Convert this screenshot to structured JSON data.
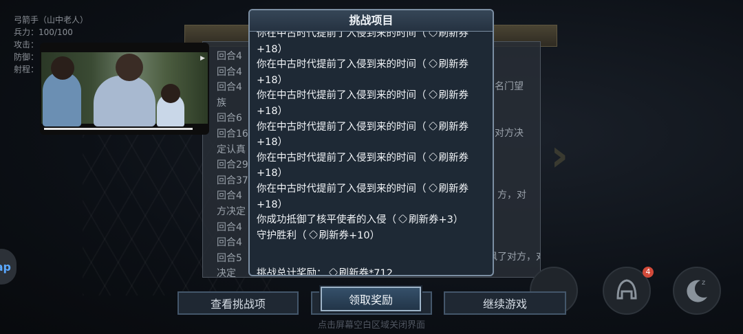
{
  "background": {
    "stats": [
      "弓箭手（山中老人）",
      "兵力：100/100",
      "攻击：",
      "防御：",
      "射程："
    ],
    "log_lines": [
      {
        "text": "回合4"
      },
      {
        "text": "回合4"
      },
      {
        "text": "回合4"
      },
      {
        "text": "族"
      },
      {
        "text": "回合6"
      },
      {
        "text": "回合16"
      },
      {
        "text": "定认真"
      },
      {
        "text": "回合29"
      },
      {
        "text": "回合37"
      },
      {
        "text": "回合4"
      },
      {
        "text": "方决定"
      },
      {
        "text": "回合4"
      },
      {
        "text": "回合4"
      },
      {
        "text": "回合5"
      },
      {
        "text": "决定"
      }
    ],
    "log_right": [
      {
        "text": "名门望"
      },
      {
        "text": "对方决"
      },
      {
        "text": "方，对"
      },
      {
        "text": "的骑士，你嘲讽了对方，对方"
      }
    ],
    "tap_label": "ap",
    "notification_count": "4"
  },
  "modal": {
    "title": "挑战项目",
    "entries": [
      "你在中古时代提前了入侵到来的时间（[t]刷新券+18）",
      "你在中古时代提前了入侵到来的时间（[t]刷新券+18）",
      "你在中古时代提前了入侵到来的时间（[t]刷新券+18）",
      "你在中古时代提前了入侵到来的时间（[t]刷新券+18）",
      "你在中古时代提前了入侵到来的时间（[t]刷新券+18）",
      "你在中古时代提前了入侵到来的时间（[t]刷新券+18）",
      "你成功抵御了核平使者的入侵（[t]刷新券+3）",
      "守护胜利（[t]刷新券+10）"
    ],
    "total_label": "挑战总计奖励：",
    "total_value": "刷新券*712",
    "ticket_icon": "ticket-icon"
  },
  "buttons": {
    "view_challenges": "查看挑战项",
    "claim_reward": "领取奖励",
    "continue_game": "继续游戏"
  },
  "hint": "点击屏幕空白区域关闭界面",
  "colors": {
    "modal_bg": "#1e2935",
    "modal_border": "#7c8fa3",
    "button_border": "#44576b",
    "primary_border": "#9fb5c9"
  }
}
